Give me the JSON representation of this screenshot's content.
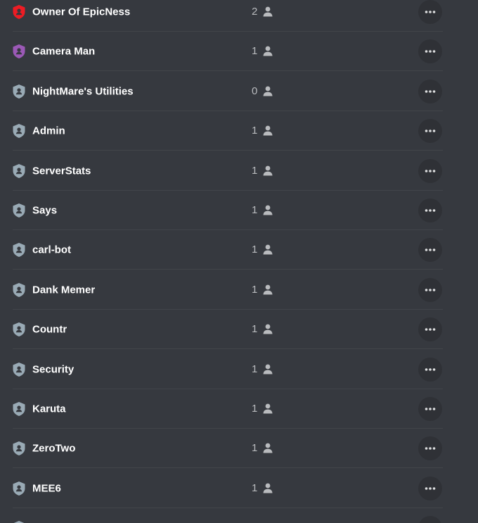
{
  "roles": [
    {
      "name": "Owner Of EpicNess",
      "count": "2",
      "color": "#ed1c24"
    },
    {
      "name": "Camera Man",
      "count": "1",
      "color": "#9b59b6"
    },
    {
      "name": "NightMare's Utilities",
      "count": "0",
      "color": "#99aab5"
    },
    {
      "name": "Admin",
      "count": "1",
      "color": "#99aab5"
    },
    {
      "name": "ServerStats",
      "count": "1",
      "color": "#99aab5"
    },
    {
      "name": "Says",
      "count": "1",
      "color": "#99aab5"
    },
    {
      "name": "carl-bot",
      "count": "1",
      "color": "#99aab5"
    },
    {
      "name": "Dank Memer",
      "count": "1",
      "color": "#99aab5"
    },
    {
      "name": "Countr",
      "count": "1",
      "color": "#99aab5"
    },
    {
      "name": "Security",
      "count": "1",
      "color": "#99aab5"
    },
    {
      "name": "Karuta",
      "count": "1",
      "color": "#99aab5"
    },
    {
      "name": "ZeroTwo",
      "count": "1",
      "color": "#99aab5"
    },
    {
      "name": "MEE6",
      "count": "1",
      "color": "#99aab5"
    },
    {
      "name": "",
      "count": "",
      "color": "#99aab5"
    }
  ],
  "icons": {
    "role": "shield-icon",
    "member": "person-icon",
    "more": "more-options-icon"
  }
}
